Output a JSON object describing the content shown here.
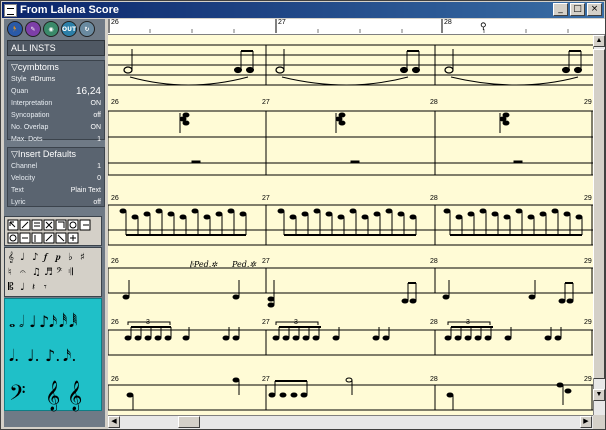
{
  "window": {
    "title": "From Lalena Score"
  },
  "titlebar_buttons": {
    "minimize": "_",
    "maximize": "□",
    "close": "×"
  },
  "toolbar": {
    "icons": [
      {
        "name": "pointer-tool-icon",
        "color": "#2a5aa8",
        "label": ""
      },
      {
        "name": "pencil-tool-icon",
        "color": "#7d3fa8",
        "label": ""
      },
      {
        "name": "eraser-tool-icon",
        "color": "#3a8a6a",
        "label": ""
      },
      {
        "name": "out-tool-icon",
        "color": "#2c7fa8",
        "label": "OUT"
      },
      {
        "name": "loop-tool-icon",
        "color": "#6a8aa0",
        "label": ""
      }
    ]
  },
  "inspector": {
    "all_insts": "ALL INSTS",
    "instrument": {
      "header": "▽cymbtoms",
      "style_label": "Style",
      "style_value": "#Drums",
      "quant_label": "Quan",
      "quant_value": "16,24",
      "rows": [
        {
          "label": "Interpretation",
          "value": "ON"
        },
        {
          "label": "Syncopation",
          "value": "off"
        },
        {
          "label": "No. Overlap",
          "value": "ON"
        },
        {
          "label": "Max. Dots",
          "value": "1"
        }
      ]
    },
    "insert": {
      "header": "▽Insert Defaults",
      "rows": [
        {
          "label": "Channel",
          "value": "1"
        },
        {
          "label": "Velocity",
          "value": "0"
        },
        {
          "label": "Text",
          "value": "Plain Text"
        },
        {
          "label": "Lyric",
          "value": "off"
        }
      ]
    }
  },
  "ruler": {
    "bars": [
      "26",
      "27",
      "28"
    ]
  },
  "score": {
    "measure_numbers": [
      "26",
      "27",
      "28",
      "29"
    ],
    "pedal_marks": [
      "𝄆Ped.✲",
      "Ped.✲"
    ],
    "triplet_label": "3"
  }
}
